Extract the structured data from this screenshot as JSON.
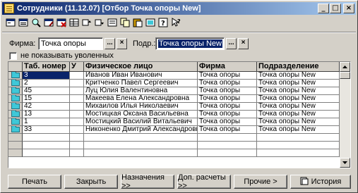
{
  "window": {
    "title": "Сотрудники (11.12.07) [Отбор Точка опоры New]",
    "min": "_",
    "max": "□",
    "close": "×"
  },
  "toolbar": {
    "icons": [
      "new-record-icon",
      "copy-record-icon",
      "find-icon",
      "edit-list-icon",
      "delete-icon",
      "grid-icon",
      "move-up-icon",
      "move-down-icon",
      "filter-icon",
      "copy-icon",
      "paste-icon",
      "refresh-icon",
      "help-icon",
      "pointer-help-icon"
    ]
  },
  "filter": {
    "firm_label": "Фирма:",
    "firm_value": "Точка опоры",
    "div_label": "Подр.:",
    "div_value": "Точка опоры New",
    "browse": "...",
    "clear": "×"
  },
  "checkbox": {
    "label": "не показывать уволенных",
    "checked": false
  },
  "grid": {
    "columns": [
      "Таб. номер",
      "У",
      "Физическое лицо",
      "Фирма",
      "Подразделение"
    ],
    "rows": [
      [
        "3",
        "",
        "Иванов Иван Иванович",
        "Точка опоры",
        "Точка опоры New"
      ],
      [
        "2",
        "",
        "Критченко Павел Сергеевич",
        "Точка опоры",
        "Точка опоры New"
      ],
      [
        "45",
        "",
        "Луц Юлия Валентиновна",
        "Точка опоры",
        "Точка опоры New"
      ],
      [
        "15",
        "",
        "Макеева Елена Александровна",
        "Точка опоры",
        "Точка опоры New"
      ],
      [
        "42",
        "",
        "Михаилов Илья Николаевич",
        "Точка опоры",
        "Точка опоры New"
      ],
      [
        "13",
        "",
        "Мостицкая Оксана Васильевна",
        "Точка опоры",
        "Точка опоры New"
      ],
      [
        "1",
        "",
        "Мостицкий Василий Витальевич",
        "Точка опоры",
        "Точка опоры New"
      ],
      [
        "33",
        "",
        "Никоненко Дмитрий Александрович",
        "Точка опоры",
        "Точка опоры New"
      ],
      [
        "",
        "",
        "",
        "",
        ""
      ],
      [
        "",
        "",
        "",
        "",
        ""
      ],
      [
        "",
        "",
        "",
        "",
        ""
      ]
    ],
    "selected_row": 0
  },
  "buttons": {
    "print": "Печать",
    "close": "Закрыть",
    "assignments": "Назначения >>",
    "extra_calc": "Доп. расчеты >>",
    "other": "Прочие >",
    "history": "История"
  }
}
